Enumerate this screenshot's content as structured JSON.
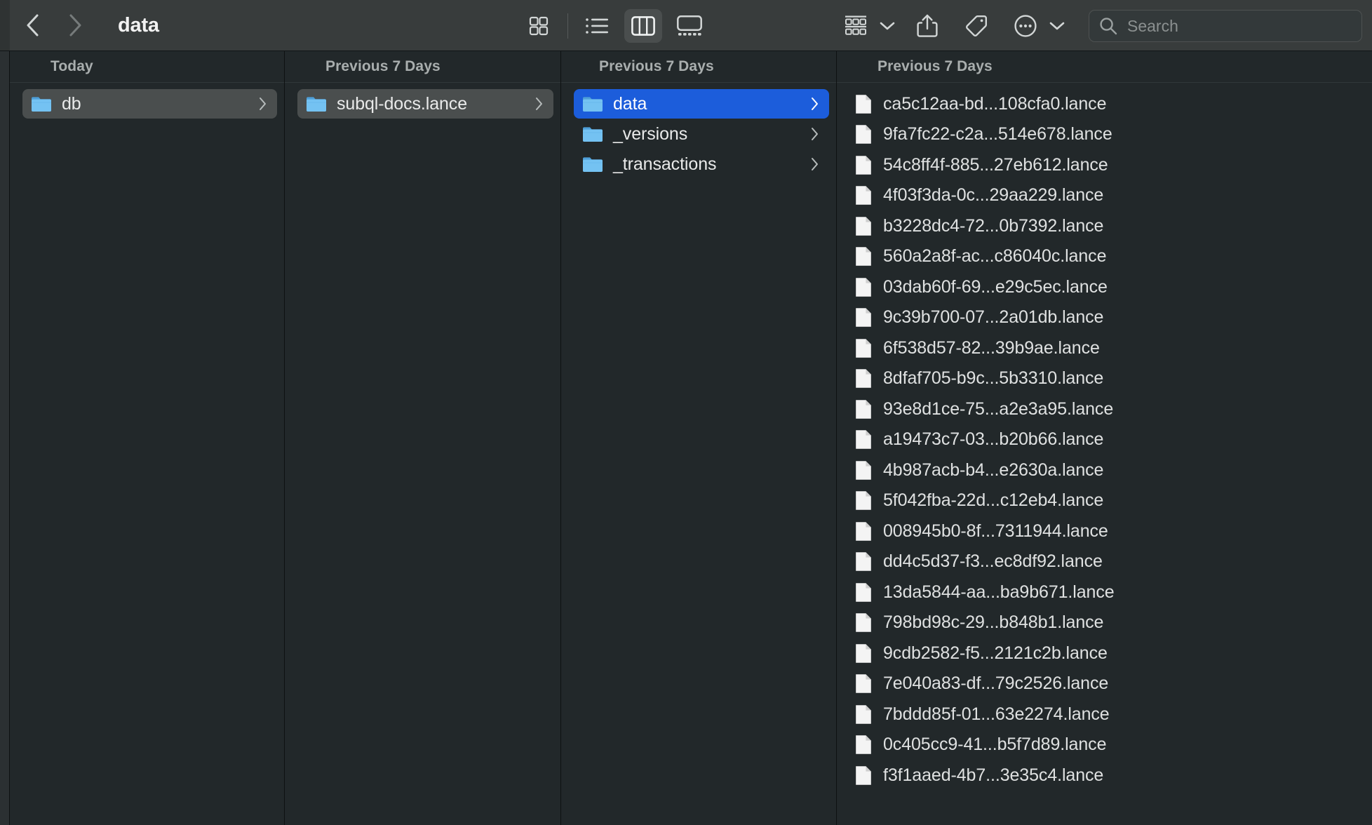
{
  "window": {
    "title": "data",
    "app": "Finder"
  },
  "toolbar": {
    "back_label": "Back",
    "forward_label": "Forward",
    "view_icon_grid": "grid-view-icon",
    "view_icon_list": "list-view-icon",
    "view_icon_column": "column-view-icon",
    "view_icon_gallery": "gallery-view-icon",
    "group_label": "Group",
    "share_label": "Share",
    "tags_label": "Tags",
    "more_label": "More",
    "active_view": "column"
  },
  "search": {
    "placeholder": "Search",
    "value": ""
  },
  "colors": {
    "toolbar_bg": "#383c3c",
    "content_bg": "#22282a",
    "selection_active": "#1c5ddb",
    "selection_inactive": "#4a4e4e",
    "folder_blue": "#63b8f0",
    "text_primary": "#e9eaea",
    "text_header": "#a9aeae"
  },
  "columns": [
    {
      "header": "Today",
      "items": [
        {
          "name": "db",
          "kind": "folder",
          "selected": "inactive",
          "chevron": true
        }
      ]
    },
    {
      "header": "Previous 7 Days",
      "items": [
        {
          "name": "subql-docs.lance",
          "kind": "folder",
          "selected": "inactive",
          "chevron": true
        }
      ]
    },
    {
      "header": "Previous 7 Days",
      "items": [
        {
          "name": "data",
          "kind": "folder",
          "selected": "active",
          "chevron": true
        },
        {
          "name": "_versions",
          "kind": "folder",
          "selected": "none",
          "chevron": true
        },
        {
          "name": "_transactions",
          "kind": "folder",
          "selected": "none",
          "chevron": true
        }
      ]
    },
    {
      "header": "Previous 7 Days",
      "items": [
        {
          "name": "ca5c12aa-bd...108cfa0.lance",
          "kind": "file",
          "selected": "none",
          "chevron": false
        },
        {
          "name": "9fa7fc22-c2a...514e678.lance",
          "kind": "file",
          "selected": "none",
          "chevron": false
        },
        {
          "name": "54c8ff4f-885...27eb612.lance",
          "kind": "file",
          "selected": "none",
          "chevron": false
        },
        {
          "name": "4f03f3da-0c...29aa229.lance",
          "kind": "file",
          "selected": "none",
          "chevron": false
        },
        {
          "name": "b3228dc4-72...0b7392.lance",
          "kind": "file",
          "selected": "none",
          "chevron": false
        },
        {
          "name": "560a2a8f-ac...c86040c.lance",
          "kind": "file",
          "selected": "none",
          "chevron": false
        },
        {
          "name": "03dab60f-69...e29c5ec.lance",
          "kind": "file",
          "selected": "none",
          "chevron": false
        },
        {
          "name": "9c39b700-07...2a01db.lance",
          "kind": "file",
          "selected": "none",
          "chevron": false
        },
        {
          "name": "6f538d57-82...39b9ae.lance",
          "kind": "file",
          "selected": "none",
          "chevron": false
        },
        {
          "name": "8dfaf705-b9c...5b3310.lance",
          "kind": "file",
          "selected": "none",
          "chevron": false
        },
        {
          "name": "93e8d1ce-75...a2e3a95.lance",
          "kind": "file",
          "selected": "none",
          "chevron": false
        },
        {
          "name": "a19473c7-03...b20b66.lance",
          "kind": "file",
          "selected": "none",
          "chevron": false
        },
        {
          "name": "4b987acb-b4...e2630a.lance",
          "kind": "file",
          "selected": "none",
          "chevron": false
        },
        {
          "name": "5f042fba-22d...c12eb4.lance",
          "kind": "file",
          "selected": "none",
          "chevron": false
        },
        {
          "name": "008945b0-8f...7311944.lance",
          "kind": "file",
          "selected": "none",
          "chevron": false
        },
        {
          "name": "dd4c5d37-f3...ec8df92.lance",
          "kind": "file",
          "selected": "none",
          "chevron": false
        },
        {
          "name": "13da5844-aa...ba9b671.lance",
          "kind": "file",
          "selected": "none",
          "chevron": false
        },
        {
          "name": "798bd98c-29...b848b1.lance",
          "kind": "file",
          "selected": "none",
          "chevron": false
        },
        {
          "name": "9cdb2582-f5...2121c2b.lance",
          "kind": "file",
          "selected": "none",
          "chevron": false
        },
        {
          "name": "7e040a83-df...79c2526.lance",
          "kind": "file",
          "selected": "none",
          "chevron": false
        },
        {
          "name": "7bddd85f-01...63e2274.lance",
          "kind": "file",
          "selected": "none",
          "chevron": false
        },
        {
          "name": "0c405cc9-41...b5f7d89.lance",
          "kind": "file",
          "selected": "none",
          "chevron": false
        },
        {
          "name": "f3f1aaed-4b7...3e35c4.lance",
          "kind": "file",
          "selected": "none",
          "chevron": false
        }
      ]
    }
  ]
}
